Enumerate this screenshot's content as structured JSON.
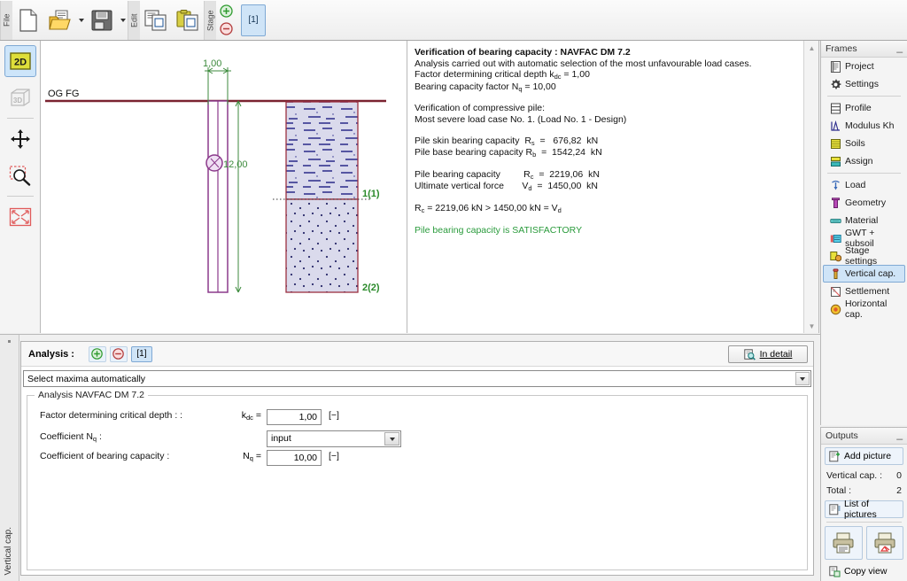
{
  "toolbar": {
    "groups": [
      {
        "label": "File",
        "buttons": [
          {
            "name": "new-document-button",
            "icon": "new-document-icon"
          },
          {
            "name": "open-file-button",
            "icon": "open-folder-icon",
            "caret": true
          },
          {
            "name": "save-file-button",
            "icon": "floppy-disk-icon",
            "caret": true
          }
        ]
      },
      {
        "label": "Edit",
        "buttons": [
          {
            "name": "copy-button",
            "icon": "copy-icon"
          },
          {
            "name": "paste-button",
            "icon": "paste-icon"
          }
        ]
      },
      {
        "label": "Stage",
        "buttons": [
          {
            "name": "add-stage-button",
            "icon": "plus-circle-icon"
          },
          {
            "name": "remove-stage-button",
            "icon": "minus-circle-icon"
          }
        ]
      }
    ],
    "stage_number": "[1]"
  },
  "left_tools": [
    {
      "name": "view-2d-button",
      "icon": "2d-icon",
      "label": "2D",
      "selected": true
    },
    {
      "name": "view-3d-button",
      "icon": "3d-icon",
      "label": "3D",
      "selected": false
    },
    {
      "name": "pan-tool-button",
      "icon": "move-arrows-icon",
      "selected": false
    },
    {
      "name": "zoom-window-button",
      "icon": "zoom-region-icon",
      "selected": false
    },
    {
      "name": "zoom-all-button",
      "icon": "zoom-extents-icon",
      "selected": false
    },
    {
      "name": "view-settings-button",
      "icon": "gear-icon",
      "selected": false
    }
  ],
  "drawing": {
    "ground_label": "OG FG",
    "pile_width_dim": "1,00",
    "pile_depth_dim": "12,00",
    "soil_labels": [
      {
        "name": "soil-layer-1-label",
        "text": "1(1)"
      },
      {
        "name": "soil-layer-2-label",
        "text": "2(2)"
      }
    ],
    "colors": {
      "ground_line": "#7a2230",
      "pile_outline": "#8b3a8b",
      "dimension": "#3c8a3c",
      "soil_fill": "#dadaec",
      "soil_border": "#9b3040",
      "layer_label": "#2a8a2a"
    }
  },
  "results": {
    "title": "Verification of bearing capacity : NAVFAC DM 7.2",
    "lines": [
      "Analysis carried out with automatic selection of the most unfavourable load cases.",
      "Factor determining critical depth k_dc = 1,00",
      "Bearing capacity factor N_q = 10,00"
    ],
    "verification_header": "Verification of compressive pile:",
    "load_case": "Most severe load case No.  1. (Load No.  1 - Design)",
    "rows": [
      {
        "label": "Pile skin bearing capacity",
        "sym": "R",
        "sub": "s",
        "eq": "=",
        "value": "676,82",
        "unit": "kN"
      },
      {
        "label": "Pile base bearing capacity",
        "sym": "R",
        "sub": "b",
        "eq": "=",
        "value": "1542,24",
        "unit": "kN"
      }
    ],
    "rows2": [
      {
        "label": "Pile bearing capacity",
        "sym": "R",
        "sub": "c",
        "eq": "=",
        "value": "2219,06",
        "unit": "kN"
      },
      {
        "label": "Ultimate vertical force",
        "sym": "V",
        "sub": "d",
        "eq": "=",
        "value": "1450,00",
        "unit": "kN"
      }
    ],
    "comparison": "R_c = 2219,06 kN > 1450,00 kN = V_d",
    "verdict": "Pile bearing capacity is SATISFACTORY",
    "verdict_color": "#2a9b3c"
  },
  "frames": {
    "title": "Frames",
    "items": [
      {
        "label": "Project",
        "icon": "document-icon",
        "selected": false
      },
      {
        "label": "Settings",
        "icon": "gear-icon",
        "selected": false
      },
      {
        "sep": true
      },
      {
        "label": "Profile",
        "icon": "profile-layers-icon",
        "selected": false
      },
      {
        "label": "Modulus Kh",
        "icon": "modulus-chart-icon",
        "selected": false
      },
      {
        "label": "Soils",
        "icon": "soils-hatch-icon",
        "selected": false
      },
      {
        "label": "Assign",
        "icon": "assign-icon",
        "selected": false
      },
      {
        "sep": true
      },
      {
        "label": "Load",
        "icon": "load-arrow-icon",
        "selected": false
      },
      {
        "label": "Geometry",
        "icon": "geometry-pile-icon",
        "selected": false
      },
      {
        "label": "Material",
        "icon": "material-bar-icon",
        "selected": false
      },
      {
        "label": "GWT + subsoil",
        "icon": "water-table-icon",
        "selected": false
      },
      {
        "label": "Stage settings",
        "icon": "stage-settings-icon",
        "selected": false
      },
      {
        "label": "Vertical cap.",
        "icon": "vertical-capacity-icon",
        "selected": true
      },
      {
        "label": "Settlement",
        "icon": "settlement-icon",
        "selected": false
      },
      {
        "label": "Horizontal cap.",
        "icon": "horizontal-capacity-icon",
        "selected": false
      }
    ]
  },
  "outputs": {
    "title": "Outputs",
    "add_picture": "Add picture",
    "counts": [
      {
        "label": "Vertical cap. :",
        "value": "0"
      },
      {
        "label": "Total :",
        "value": "2"
      }
    ],
    "list_of_pictures": "List of pictures",
    "print_buttons": [
      {
        "name": "print-document-button",
        "icon": "printer-icon"
      },
      {
        "name": "print-picture-button",
        "icon": "printer-picture-icon"
      }
    ],
    "copy_view": "Copy view"
  },
  "bottom": {
    "vertical_tab": "Vertical cap.",
    "analysis_label": "Analysis :",
    "analysis_add": "+",
    "analysis_remove": "−",
    "analysis_number": "[1]",
    "in_detail": "In detail",
    "maxima_selected": "Select maxima automatically",
    "groupbox_title": "Analysis NAVFAC DM 7.2",
    "fields": [
      {
        "label": "Factor determining critical depth : :",
        "sym": "k",
        "sub": "dc",
        "eq": "=",
        "value": "1,00",
        "unit": "[−]",
        "type": "input"
      },
      {
        "label": "Coefficient N",
        "sub_label": "q",
        "label_tail": " :",
        "value": "input",
        "type": "combo"
      },
      {
        "label": "Coefficient of bearing capacity :",
        "sym": "N",
        "sub": "q",
        "eq": "=",
        "value": "10,00",
        "unit": "[−]",
        "type": "input"
      }
    ]
  }
}
